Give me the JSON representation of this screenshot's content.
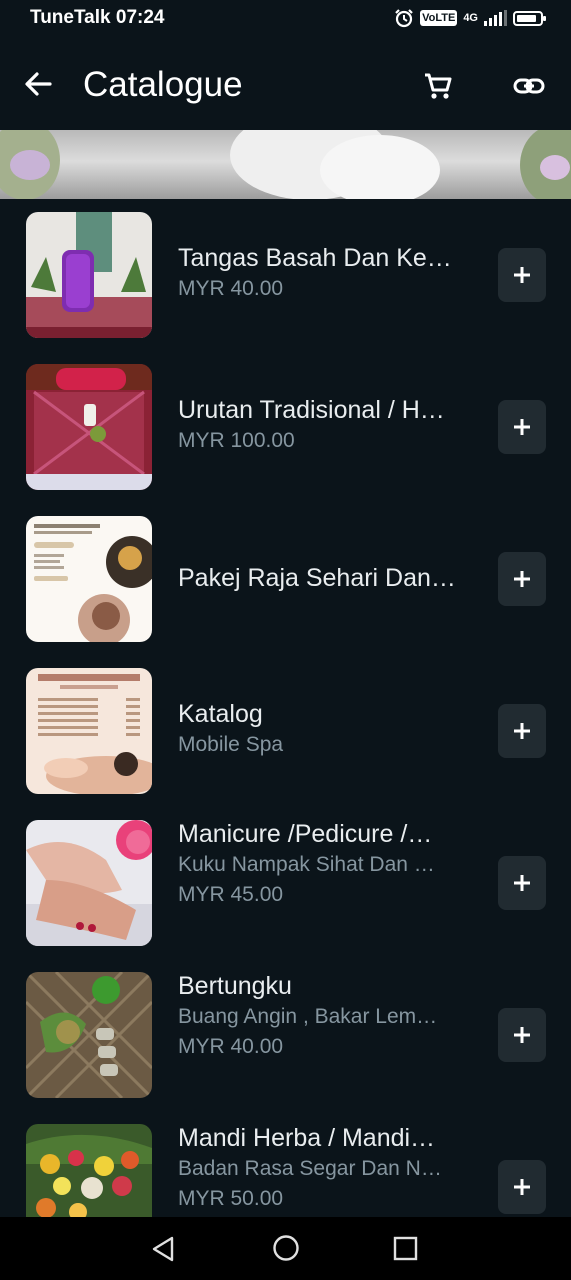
{
  "status_bar": {
    "carrier": "TuneTalk",
    "time": "07:24",
    "volte_label": "VoLTE",
    "network_label": "4G",
    "battery_level": 0.85,
    "icons": [
      "alarm-icon",
      "volte-icon",
      "signal-icon",
      "battery-icon"
    ]
  },
  "app_bar": {
    "title": "Catalogue",
    "icons": [
      "back-arrow-icon",
      "cart-icon",
      "link-icon"
    ]
  },
  "catalogue": {
    "items": [
      {
        "name": "Tangas Basah Dan Ke…",
        "line2": "",
        "price": "MYR 40.00"
      },
      {
        "name": "Urutan Tradisional / H…",
        "line2": "",
        "price": "MYR 100.00"
      },
      {
        "name": "Pakej Raja Sehari Dan…",
        "line2": "",
        "price": ""
      },
      {
        "name": "Katalog",
        "line2": "Mobile Spa",
        "price": ""
      },
      {
        "name": "Manicure /Pedicure /…",
        "line2": "Kuku Nampak Sihat Dan …",
        "price": "MYR 45.00"
      },
      {
        "name": "Bertungku",
        "line2": "Buang Angin , Bakar Lem…",
        "price": "MYR 40.00"
      },
      {
        "name": "Mandi Herba / Mandi…",
        "line2": "Badan Rasa Segar Dan N…",
        "price": "MYR 50.00"
      }
    ],
    "add_icon": "plus-icon"
  },
  "nav_bar": {
    "icons": [
      "nav-back-icon",
      "nav-home-icon",
      "nav-recents-icon"
    ]
  }
}
